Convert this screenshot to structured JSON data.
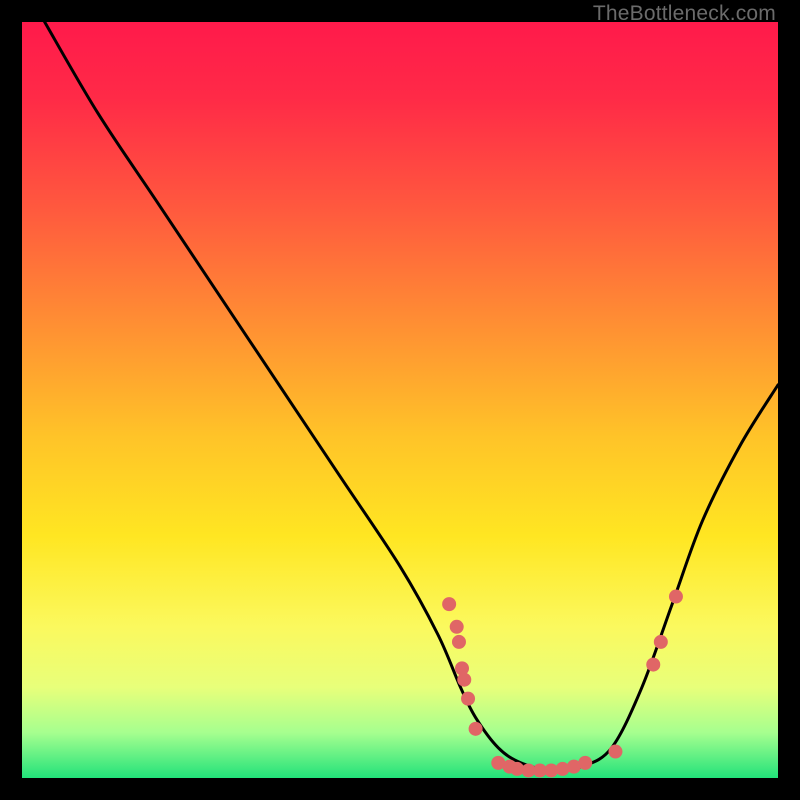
{
  "watermark": "TheBottleneck.com",
  "chart_data": {
    "type": "line",
    "title": "",
    "xlabel": "",
    "ylabel": "",
    "xlim": [
      0,
      100
    ],
    "ylim": [
      0,
      100
    ],
    "grid": false,
    "legend": false,
    "gradient_stops": [
      {
        "offset": 0,
        "color": "#ff1a4b"
      },
      {
        "offset": 0.1,
        "color": "#ff2a47"
      },
      {
        "offset": 0.25,
        "color": "#ff5a3e"
      },
      {
        "offset": 0.4,
        "color": "#ff8f33"
      },
      {
        "offset": 0.55,
        "color": "#ffc428"
      },
      {
        "offset": 0.68,
        "color": "#ffe622"
      },
      {
        "offset": 0.8,
        "color": "#fbf95e"
      },
      {
        "offset": 0.88,
        "color": "#e8ff7a"
      },
      {
        "offset": 0.94,
        "color": "#a6ff8f"
      },
      {
        "offset": 1.0,
        "color": "#22e27a"
      }
    ],
    "series": [
      {
        "name": "bottleneck-curve",
        "color": "#000000",
        "x": [
          3,
          10,
          18,
          26,
          34,
          42,
          50,
          55,
          58,
          60,
          63,
          66,
          70,
          74,
          78,
          82,
          86,
          90,
          95,
          100
        ],
        "values": [
          100,
          88,
          76,
          64,
          52,
          40,
          28,
          19,
          12,
          8,
          4,
          2,
          1,
          1.5,
          4,
          12,
          23,
          34,
          44,
          52
        ]
      }
    ],
    "scatter": {
      "name": "marker-points",
      "color": "#e06666",
      "radius": 7,
      "points": [
        {
          "x": 56.5,
          "y": 23
        },
        {
          "x": 57.5,
          "y": 20
        },
        {
          "x": 57.8,
          "y": 18
        },
        {
          "x": 58.2,
          "y": 14.5
        },
        {
          "x": 58.5,
          "y": 13
        },
        {
          "x": 59.0,
          "y": 10.5
        },
        {
          "x": 60.0,
          "y": 6.5
        },
        {
          "x": 63.0,
          "y": 2.0
        },
        {
          "x": 64.5,
          "y": 1.5
        },
        {
          "x": 65.5,
          "y": 1.2
        },
        {
          "x": 67.0,
          "y": 1.0
        },
        {
          "x": 68.5,
          "y": 1.0
        },
        {
          "x": 70.0,
          "y": 1.0
        },
        {
          "x": 71.5,
          "y": 1.2
        },
        {
          "x": 73.0,
          "y": 1.5
        },
        {
          "x": 74.5,
          "y": 2.0
        },
        {
          "x": 78.5,
          "y": 3.5
        },
        {
          "x": 83.5,
          "y": 15
        },
        {
          "x": 84.5,
          "y": 18
        },
        {
          "x": 86.5,
          "y": 24
        }
      ]
    }
  }
}
